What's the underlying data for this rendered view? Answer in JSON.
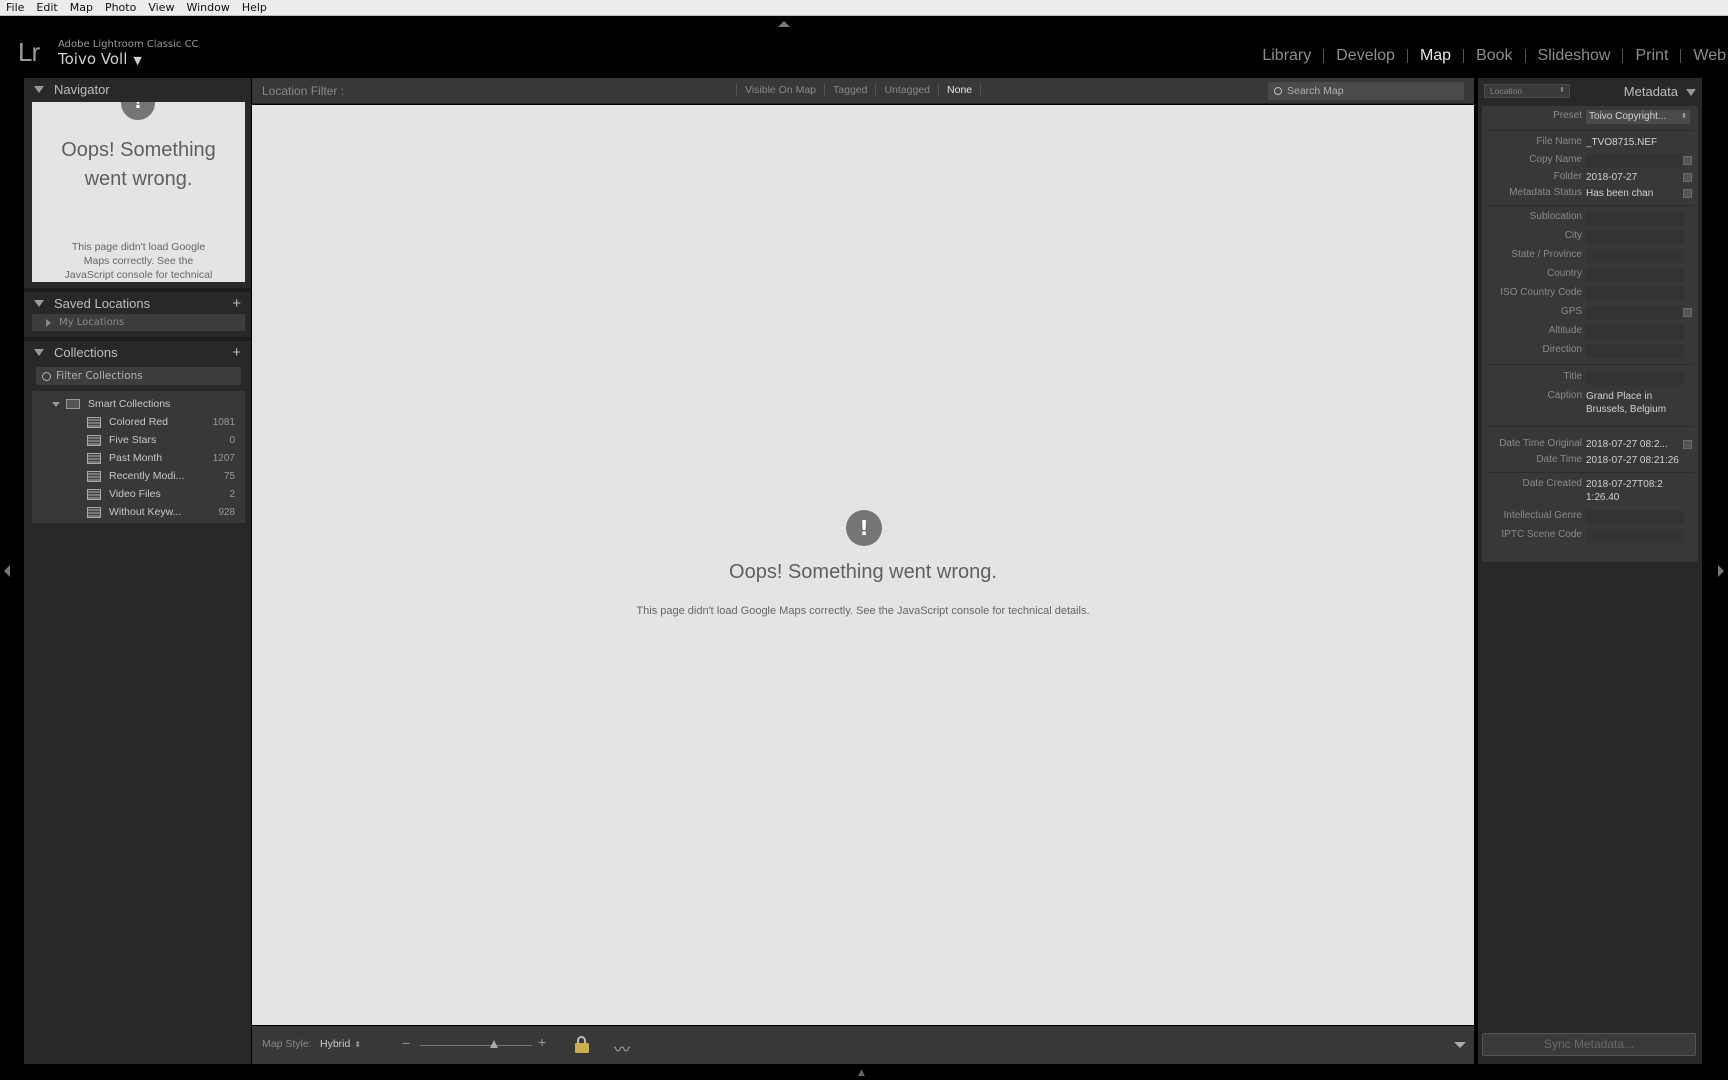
{
  "menu": [
    "File",
    "Edit",
    "Map",
    "Photo",
    "View",
    "Window",
    "Help"
  ],
  "identity": {
    "logo": "Lr",
    "app_name": "Adobe Lightroom Classic CC",
    "user": "Toivo Voll"
  },
  "modules": [
    {
      "label": "Library",
      "active": false
    },
    {
      "label": "Develop",
      "active": false
    },
    {
      "label": "Map",
      "active": true
    },
    {
      "label": "Book",
      "active": false
    },
    {
      "label": "Slideshow",
      "active": false
    },
    {
      "label": "Print",
      "active": false
    },
    {
      "label": "Web",
      "active": false
    }
  ],
  "navigator": {
    "title": "Navigator",
    "error_title": "Oops! Something went wrong.",
    "error_body": "This page didn't load Google Maps correctly. See the JavaScript console for technical"
  },
  "saved_locations": {
    "title": "Saved Locations",
    "add": "+",
    "root": "My Locations"
  },
  "collections": {
    "title": "Collections",
    "add": "+",
    "filter_placeholder": "Filter Collections",
    "group": "Smart Collections",
    "items": [
      {
        "name": "Colored Red",
        "count": "1081"
      },
      {
        "name": "Five Stars",
        "count": "0"
      },
      {
        "name": "Past Month",
        "count": "1207"
      },
      {
        "name": "Recently Modi...",
        "count": "75"
      },
      {
        "name": "Video Files",
        "count": "2"
      },
      {
        "name": "Without Keyw...",
        "count": "928"
      }
    ]
  },
  "location_filter": {
    "label": "Location Filter :",
    "options": [
      {
        "label": "Visible On Map",
        "active": false
      },
      {
        "label": "Tagged",
        "active": false
      },
      {
        "label": "Untagged",
        "active": false
      },
      {
        "label": "None",
        "active": true
      }
    ],
    "search_placeholder": "Search Map"
  },
  "map": {
    "error_icon": "!",
    "error_title": "Oops! Something went wrong.",
    "error_body": "This page didn't load Google Maps correctly. See the JavaScript console for technical details."
  },
  "map_toolbar": {
    "style_label": "Map Style:",
    "style_value": "Hybrid",
    "zoom_minus": "−",
    "zoom_plus": "+",
    "zoom_level": 0.66
  },
  "metadata": {
    "title": "Metadata",
    "set": "Location",
    "preset_label": "Preset",
    "preset_value": "Toivo Copyright...",
    "file_name_label": "File Name",
    "file_name": "_TVO8715.NEF",
    "copy_name_label": "Copy Name",
    "folder_label": "Folder",
    "folder": "2018-07-27",
    "metadata_status_label": "Metadata Status",
    "metadata_status": "Has been chan",
    "sublocation_label": "Sublocation",
    "city_label": "City",
    "state_label": "State / Province",
    "country_label": "Country",
    "iso_label": "ISO Country Code",
    "gps_label": "GPS",
    "altitude_label": "Altitude",
    "direction_label": "Direction",
    "title_label": "Title",
    "caption_label": "Caption",
    "caption": "Grand Place in Brussels, Belgium",
    "dto_label": "Date Time Original",
    "dto": "2018-07-27 08:2...",
    "dt_label": "Date Time",
    "dt": "2018-07-27 08:21:26",
    "created_label": "Date Created",
    "created": "2018-07-27T08:21:26.40",
    "genre_label": "Intellectual Genre",
    "scene_label": "IPTC Scene Code"
  },
  "sync_button": "Sync Metadata..."
}
